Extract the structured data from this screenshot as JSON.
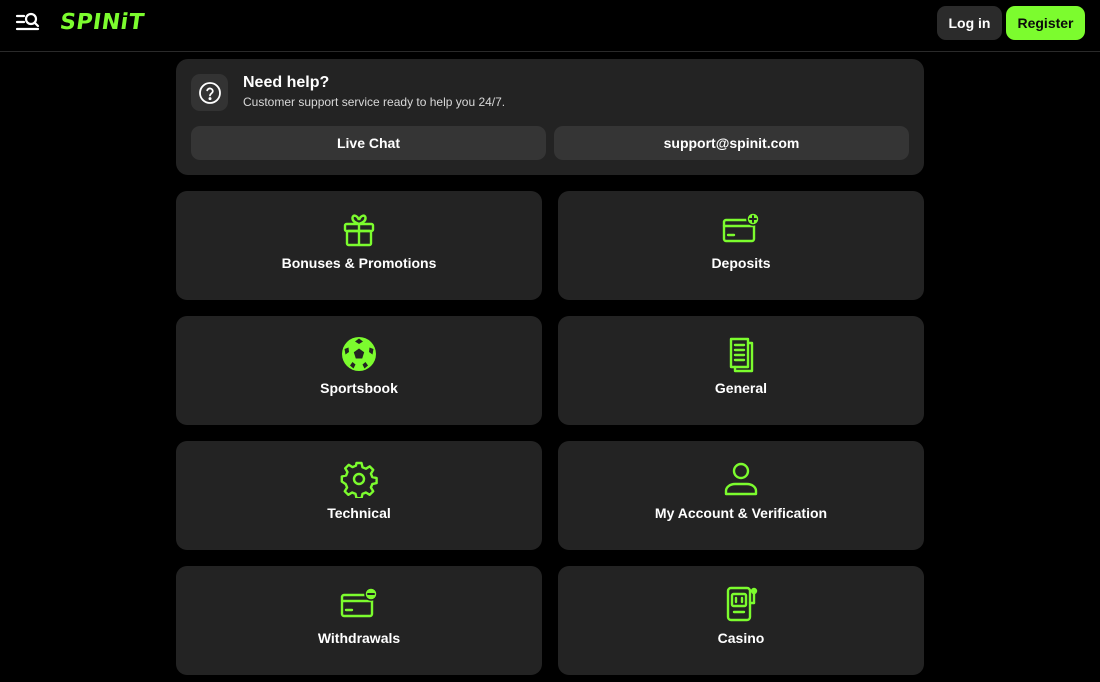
{
  "header": {
    "logo": "SPINiT",
    "login_label": "Log in",
    "register_label": "Register",
    "accent_color": "#7CFC2E"
  },
  "help": {
    "title": "Need help?",
    "subtitle": "Customer support service ready to help you 24/7.",
    "live_chat_label": "Live Chat",
    "email_label": "support@spinit.com"
  },
  "categories": [
    {
      "label": "Bonuses & Promotions",
      "icon": "gift-icon"
    },
    {
      "label": "Deposits",
      "icon": "card-plus-icon"
    },
    {
      "label": "Sportsbook",
      "icon": "soccer-ball-icon"
    },
    {
      "label": "General",
      "icon": "document-icon"
    },
    {
      "label": "Technical",
      "icon": "gear-icon"
    },
    {
      "label": "My Account & Verification",
      "icon": "user-icon"
    },
    {
      "label": "Withdrawals",
      "icon": "card-minus-icon"
    },
    {
      "label": "Casino",
      "icon": "slot-machine-icon"
    }
  ]
}
